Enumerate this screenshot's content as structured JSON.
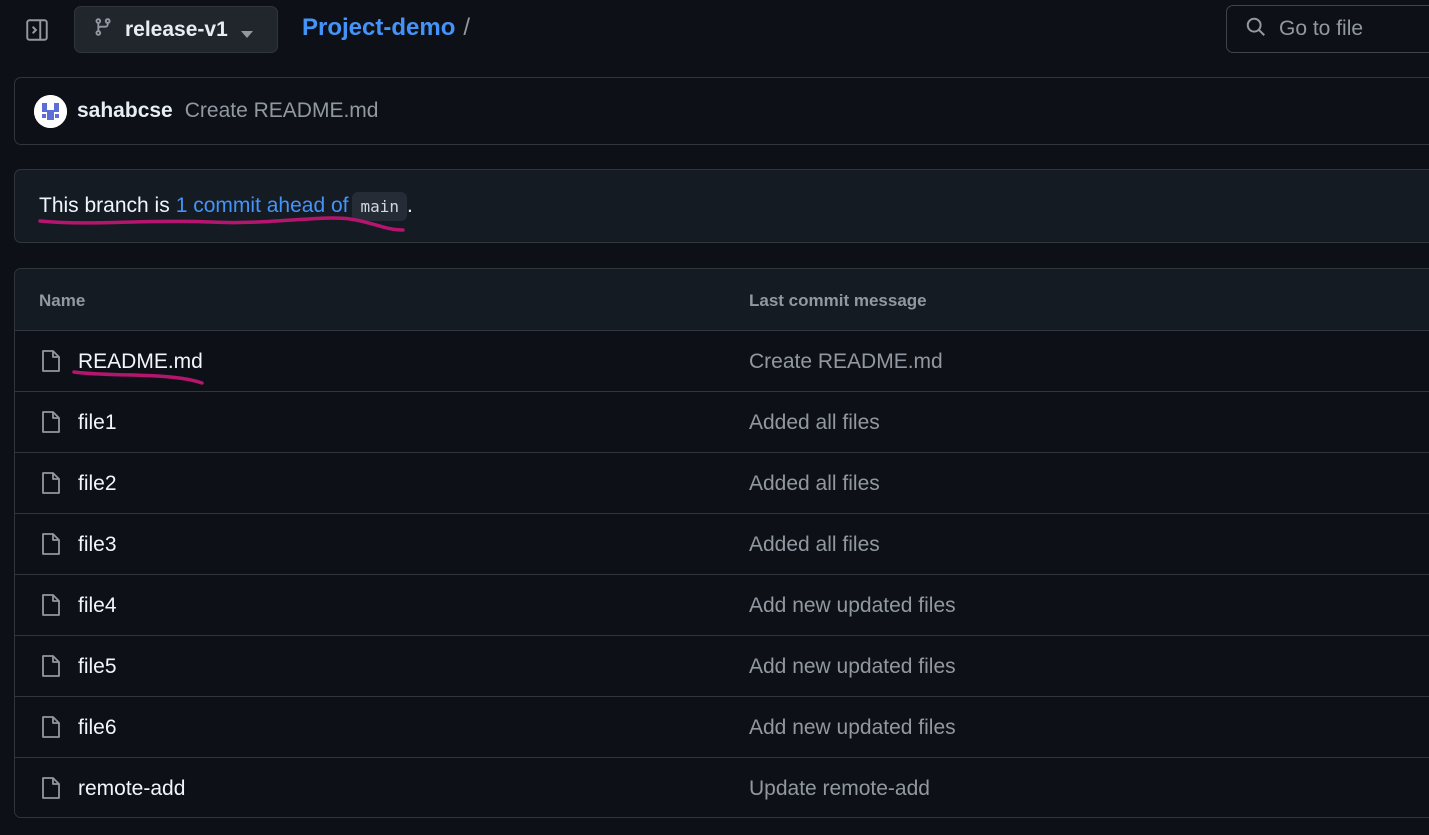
{
  "header": {
    "sidebar_toggle_icon": "sidebar-expand-icon",
    "branch": {
      "icon": "git-branch-icon",
      "label": "release-v1",
      "caret_icon": "triangle-down-icon"
    },
    "breadcrumb": {
      "repo": "Project-demo",
      "separator": "/"
    },
    "goto_file": {
      "icon": "search-icon",
      "placeholder": "Go to file"
    }
  },
  "latest_commit": {
    "author": "sahabcse",
    "message": "Create README.md"
  },
  "branch_status": {
    "prefix": "This branch is",
    "link": "1 commit ahead of",
    "base_branch": "main",
    "suffix": "."
  },
  "file_table": {
    "headers": {
      "name": "Name",
      "last_commit": "Last commit message"
    },
    "rows": [
      {
        "name": "README.md",
        "message": "Create README.md"
      },
      {
        "name": "file1",
        "message": "Added all files"
      },
      {
        "name": "file2",
        "message": "Added all files"
      },
      {
        "name": "file3",
        "message": "Added all files"
      },
      {
        "name": "file4",
        "message": "Add new updated files"
      },
      {
        "name": "file5",
        "message": "Add new updated files"
      },
      {
        "name": "file6",
        "message": "Add new updated files"
      },
      {
        "name": "remote-add",
        "message": "Update remote-add"
      }
    ]
  },
  "colors": {
    "background": "#0d1117",
    "accent_link": "#4493f8",
    "annotation_pen": "#b5156e"
  }
}
